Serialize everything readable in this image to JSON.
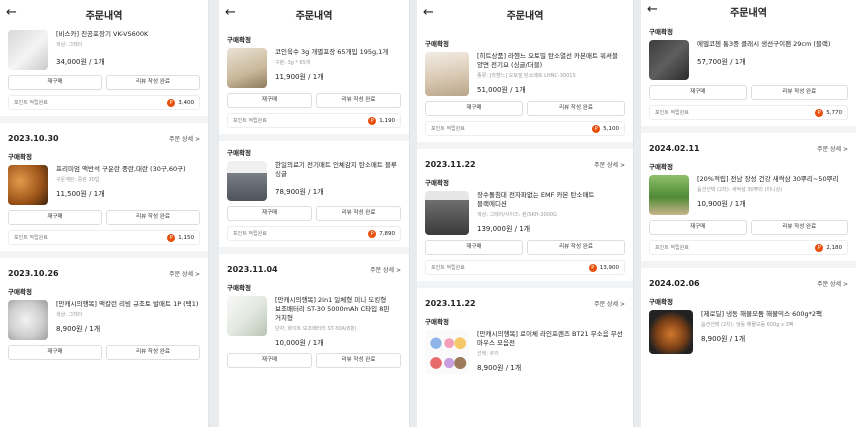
{
  "header": {
    "title": "주문내역",
    "back_icon": "arrow-left-icon"
  },
  "buttons": {
    "reorder": "재구매",
    "review_done": "리뷰 작성 완료"
  },
  "points_label": "포인트 적립완료",
  "detail_label": "주문 상세 >",
  "status_label": "구매확정",
  "panels": [
    {
      "orders": [
        {
          "date": "",
          "product": "[비스카] 진공포장기 VK-VS600K",
          "option": "색상: 그레이",
          "price": "34,000원 / 1개",
          "points": "3,400"
        },
        {
          "date": "2023.10.30",
          "product": "프리미엄 액반석 구운란 중란,대란 (30구,60구)",
          "option": "구운계란: 중란 30입",
          "price": "11,500원 / 1개",
          "points": "1,150"
        },
        {
          "date": "2023.10.26",
          "product": "[만캐시의행복] 액칼런 리빙 규조토 발매트 1P (택1)",
          "option": "색상: 그레이",
          "price": "8,900원 / 1개",
          "points": ""
        }
      ]
    },
    {
      "orders": [
        {
          "date": "",
          "product": "코인육수 3g 개별포장 65개입 195g,1개",
          "option": "구분: 3g * 65개",
          "price": "11,900원 / 1개",
          "points": "1,190"
        },
        {
          "date": "",
          "product": "한일의료기 전기매트 인체감지 탄소매트 블루 싱글",
          "option": "",
          "price": "78,900원 / 1개",
          "points": "7,890"
        },
        {
          "date": "2023.11.04",
          "product": "[만캐시의행복] 2in1 일체형 미니 도킹형 보조배터리 ST-30 5000mAh C타입 8핀 거치형",
          "option": "단자: 화이트 보조배터리 ST-30A(8핀)",
          "price": "10,000원 / 1개",
          "points": ""
        }
      ]
    },
    {
      "orders": [
        {
          "date": "",
          "product": "[히트상품] 라헨느 오토밀 탄소열선 카본매트 워셔블 양면 전기요 (싱글/더블)",
          "option": "종류: [라헨느] 오토밀 탄소매트 LHNC-3001S",
          "price": "51,000원 / 1개",
          "points": "5,100"
        },
        {
          "date": "2023.11.22",
          "product": "장수돌침대 전자파없는 EMF 카본 탄소매트 블랙에디션",
          "option": "색상: 그레이/사이즈: 퀸/SKH-2000G",
          "price": "139,000원 / 1개",
          "points": "13,900"
        },
        {
          "date": "2023.11.22",
          "product": "[만캐시의행복] 로이체 라인프렌즈 BT21 무소음 무선 마우스 모음전",
          "option": "선택: 쿠키",
          "price": "8,900원 / 1개",
          "points": ""
        }
      ]
    },
    {
      "orders": [
        {
          "date": "",
          "product": "에델코첸 통3중 클래시 생선구이팬 29cm (블랙)",
          "option": "",
          "price": "57,700원 / 1개",
          "points": "5,770"
        },
        {
          "date": "2024.02.11",
          "product": "[20%적립] 전남 장성 건강 새싹삼 30뿌리~50뿌리",
          "option": "옵션선택 (2차): 새싹삼 30뿌리 (미니상)",
          "price": "10,900원 / 1개",
          "points": "2,180"
        },
        {
          "date": "2024.02.06",
          "product": "[제로딜] 냉동 해물모둠 해물믹스 600g*2팩",
          "option": "옵션선택 (2차): 냉동 해물모둠 600g x 3팩",
          "price": "8,900원 / 1개",
          "points": ""
        }
      ]
    }
  ]
}
